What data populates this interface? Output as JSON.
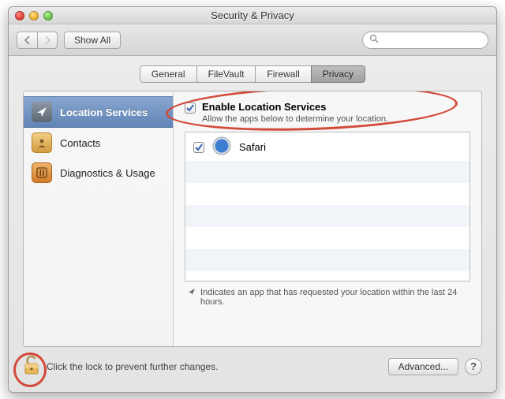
{
  "window": {
    "title": "Security & Privacy"
  },
  "toolbar": {
    "show_all_label": "Show All",
    "search_placeholder": ""
  },
  "tabs": [
    {
      "label": "General",
      "active": false
    },
    {
      "label": "FileVault",
      "active": false
    },
    {
      "label": "Firewall",
      "active": false
    },
    {
      "label": "Privacy",
      "active": true
    }
  ],
  "sidebar": {
    "items": [
      {
        "label": "Location Services",
        "selected": true
      },
      {
        "label": "Contacts",
        "selected": false
      },
      {
        "label": "Diagnostics & Usage",
        "selected": false
      }
    ]
  },
  "right": {
    "enable_label": "Enable Location Services",
    "enable_sub": "Allow the apps below to determine your location.",
    "apps": [
      {
        "label": "Safari",
        "checked": true
      }
    ],
    "indicator_note": "Indicates an app that has requested your location within the last 24 hours."
  },
  "footer": {
    "lock_text": "Click the lock to prevent further changes.",
    "advanced_label": "Advanced..."
  }
}
